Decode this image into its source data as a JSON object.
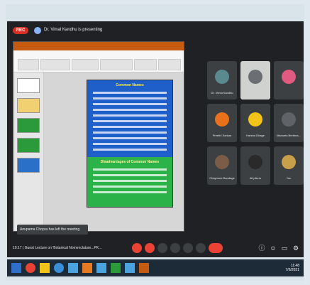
{
  "meet": {
    "rec_label": "REC",
    "presenter_text": "Dr. Vimal Kandhu is presenting",
    "meeting_time": "10:17",
    "meeting_title": "Guest Lecture on 'Botanical Nomenclature...PK...",
    "toast": "Anupama Chopra has left the meeting"
  },
  "slide": {
    "heading_blue": "Common Names",
    "heading_green": "Disadvantages of Common Names"
  },
  "participants": [
    {
      "name": "Dr. Vimal Kandhu",
      "color": "#5a8a8f"
    },
    {
      "name": "",
      "color": "#6b6f73"
    },
    {
      "name": "",
      "color": "#e05b7f"
    },
    {
      "name": "Preethi Sankar",
      "color": "#e8711a"
    },
    {
      "name": "Harsha Dhage",
      "color": "#f2c318"
    },
    {
      "name": "Manuela Brettma...",
      "color": "#5f6368"
    },
    {
      "name": "Chaymore Bandage",
      "color": "#7a5c48"
    },
    {
      "name": "All pikers",
      "color": "#2a2a2a"
    },
    {
      "name": "You",
      "color": "#c9a04a"
    }
  ],
  "tray": {
    "time": "11:48",
    "date": "7/6/2021"
  },
  "colors": {
    "accent_red": "#d93025",
    "blue_slide": "#1e5fc9",
    "green_slide": "#2bb34a"
  }
}
